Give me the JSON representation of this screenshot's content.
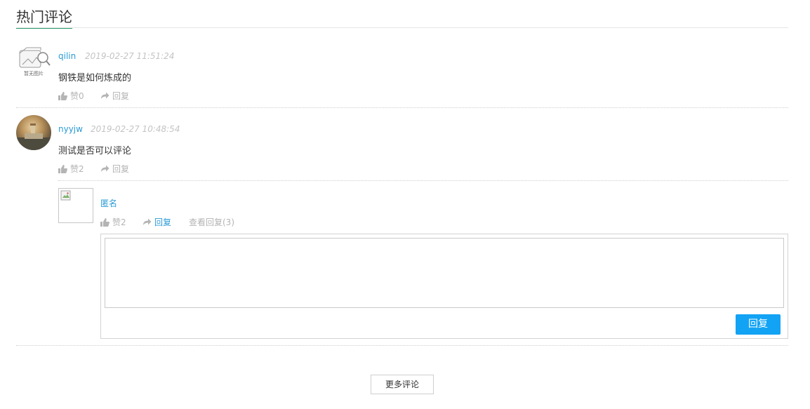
{
  "section": {
    "title": "热门评论"
  },
  "comments": [
    {
      "username": "qilin",
      "timestamp": "2019-02-27 11:51:24",
      "content": "钢铁是如何炼成的",
      "avatar_placeholder": "暂无图片",
      "like_label": "赞0",
      "reply_label": "回复"
    },
    {
      "username": "nyyjw",
      "timestamp": "2019-02-27 10:48:54",
      "content": "测试是否可以评论",
      "like_label": "赞2",
      "reply_label": "回复",
      "replies": [
        {
          "username": "匿名",
          "like_label": "赞2",
          "reply_label": "回复",
          "view_replies_label": "查看回复(3)"
        }
      ]
    }
  ],
  "reply_form": {
    "submit_label": "回复",
    "textarea_value": ""
  },
  "more_comments_label": "更多评论",
  "colors": {
    "accent": "#2a9d6c",
    "link": "#2a9bd6",
    "button": "#13a3f4",
    "muted": "#b4b4b4"
  }
}
